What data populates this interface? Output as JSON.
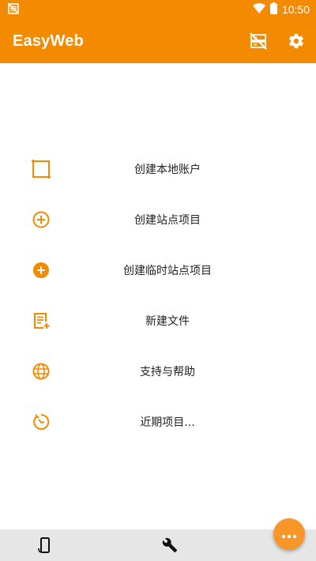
{
  "status_bar": {
    "time": "10:50",
    "icons": [
      "no-sim-icon",
      "wifi-icon",
      "battery-icon"
    ]
  },
  "app_bar": {
    "title": "EasyWeb",
    "actions": [
      "server-off-icon",
      "settings-icon"
    ]
  },
  "menu": {
    "items": [
      {
        "label": "创建本地账户",
        "icon": "crop-square-icon"
      },
      {
        "label": "创建站点项目",
        "icon": "add-circle-outline-icon"
      },
      {
        "label": "创建临时站点项目",
        "icon": "add-circle-filled-icon"
      },
      {
        "label": "新建文件",
        "icon": "new-file-icon"
      },
      {
        "label": "支持与帮助",
        "icon": "globe-icon"
      },
      {
        "label": "近期项目...",
        "icon": "history-icon"
      }
    ]
  },
  "bottom_bar": {
    "icons": [
      "phone-rotate-icon",
      "wrench-icon"
    ]
  },
  "fab": {
    "icon": "more-horizontal-icon"
  },
  "colors": {
    "primary": "#f48a00",
    "accent": "#f8962a",
    "bottom_bar": "#e6e6e6",
    "text": "#222222"
  }
}
